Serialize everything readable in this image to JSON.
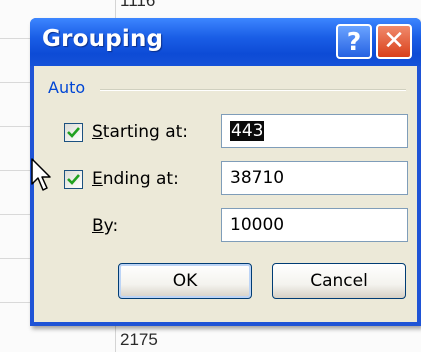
{
  "background": {
    "top_cell_value": "1116",
    "bottom_cell_value": "2175"
  },
  "dialog": {
    "title": "Grouping",
    "help_glyph": "?",
    "close_glyph": "✕",
    "group_label": "Auto",
    "starting_at": {
      "label_accesskey": "S",
      "label_rest": "tarting at:",
      "checked": true,
      "value": "443"
    },
    "ending_at": {
      "label_accesskey": "E",
      "label_rest": "nding at:",
      "checked": true,
      "value": "38710"
    },
    "by": {
      "label_accesskey": "B",
      "label_rest": "y:",
      "value": "10000"
    },
    "ok_label": "OK",
    "cancel_label": "Cancel"
  },
  "colors": {
    "titlebar": "#0d4bd6",
    "group_label": "#0046d5",
    "dialog_body": "#ece9d8"
  },
  "icons": {
    "help": "help-icon",
    "close": "close-icon",
    "check": "checkmark-icon",
    "cursor": "mouse-pointer-icon"
  }
}
